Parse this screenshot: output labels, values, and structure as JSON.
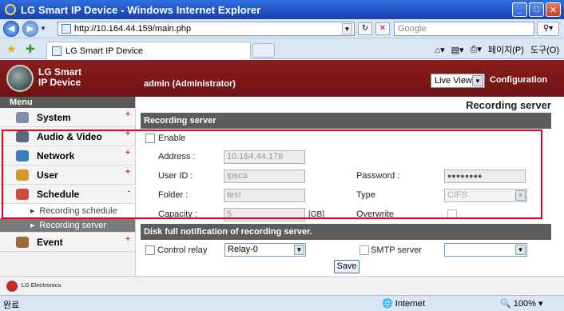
{
  "window": {
    "title": "LG Smart IP Device - Windows Internet Explorer"
  },
  "browser": {
    "address": "http://10.164.44.159/main.php",
    "search_placeholder": "Google",
    "tab_title": "LG Smart IP Device",
    "page_menu": "페이지(P)",
    "tools_menu": "도구(O)"
  },
  "header": {
    "brand_line1": "LG Smart",
    "brand_line2": "IP Device",
    "user": "admin (Administrator)",
    "view_select": "Live View",
    "configuration": "Configuration"
  },
  "sidebar": {
    "title": "Menu",
    "items": [
      {
        "label": "System",
        "toggle": "+"
      },
      {
        "label": "Audio & Video",
        "toggle": "+"
      },
      {
        "label": "Network",
        "toggle": "+"
      },
      {
        "label": "User",
        "toggle": "+"
      },
      {
        "label": "Schedule",
        "toggle": "-"
      },
      {
        "label": "Event",
        "toggle": "+"
      }
    ],
    "sub_items": [
      {
        "label": "Recording schedule"
      },
      {
        "label": "Recording server"
      }
    ]
  },
  "main": {
    "page_title": "Recording server",
    "section1": "Recording server",
    "enable": "Enable",
    "address_label": "Address :",
    "address_value": "10.164.44.178",
    "userid_label": "User ID :",
    "userid_value": "ipsca",
    "password_label": "Password :",
    "password_value": "●●●●●●●●",
    "folder_label": "Folder :",
    "folder_value": "test",
    "type_label": "Type",
    "type_value": "CIFS",
    "capacity_label": "Capacity :",
    "capacity_value": "5",
    "capacity_unit": "[GB]",
    "overwrite_label": "Overwrite",
    "section2": "Disk full notification of recording server.",
    "control_relay_label": "Control relay",
    "relay_value": "Relay-0",
    "smtp_label": "SMTP server",
    "smtp_value": "",
    "save": "Save"
  },
  "footer": {
    "brand": "LG Electronics"
  },
  "statusbar": {
    "state": "완료",
    "zone": "Internet",
    "zoom": "100%"
  }
}
